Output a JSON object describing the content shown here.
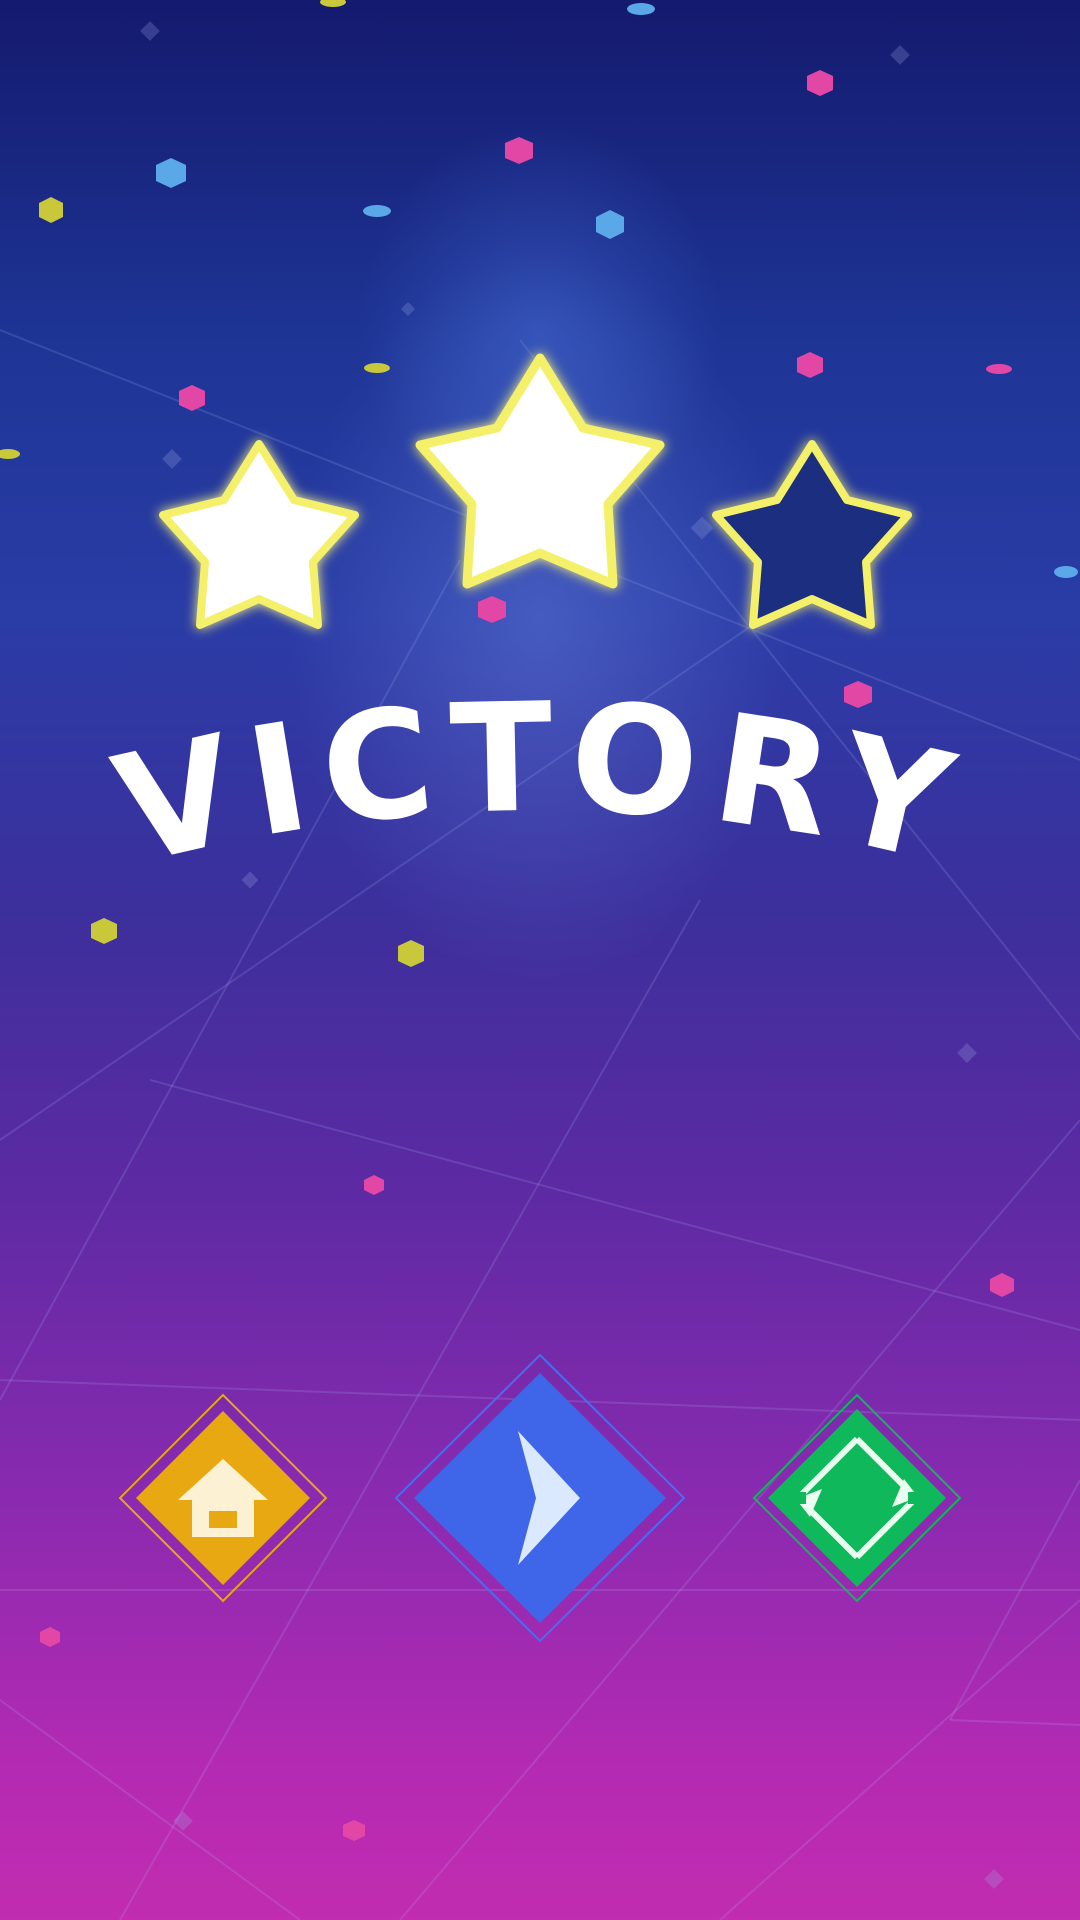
{
  "screen": {
    "title": "VICTORY",
    "result": "level-complete"
  },
  "rating": {
    "stars_earned": 2,
    "stars_total": 3,
    "filled_color": "#ffffff",
    "empty_color": "#1c2d80",
    "glow_color": "#f4f06a"
  },
  "actions": {
    "home": {
      "icon": "home-icon",
      "color": "#e8a812"
    },
    "next": {
      "icon": "chevron-right-icon",
      "color": "#3f66e8"
    },
    "restart": {
      "icon": "restart-icon",
      "color": "#0fb85a"
    }
  },
  "colors": {
    "background_top": "#141a6e",
    "background_bottom": "#c12cb0",
    "confetti": [
      "#e347a6",
      "#5aa8e8",
      "#c8c83a"
    ]
  }
}
